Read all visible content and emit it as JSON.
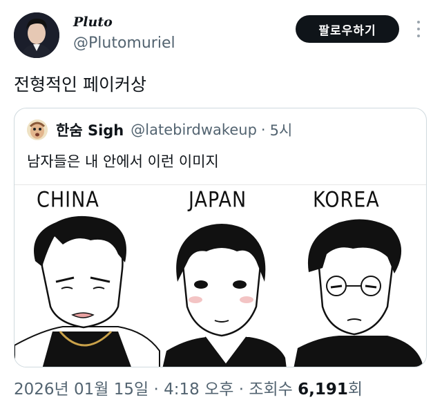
{
  "author": {
    "display_name": "Pluto",
    "handle": "@Plutomuriel",
    "follow_label": "팔로우하기"
  },
  "tweet": {
    "text": "전형적인 페이커상"
  },
  "quoted": {
    "display_name": "한숨 Sigh",
    "handle": "@latebirdwakeup",
    "separator": "·",
    "time": "5시",
    "text": "남자들은 내 안에서 이런 이미지",
    "image": {
      "labels": [
        "CHINA",
        "JAPAN",
        "KOREA"
      ]
    }
  },
  "meta": {
    "date": "2026년 01월 15일",
    "sep1": "·",
    "time": "4:18 오후",
    "sep2": "·",
    "views_label": "조회수",
    "views_count": "6,191",
    "views_suffix": "회"
  },
  "icons": {
    "more": "more-vertical-icon"
  },
  "colors": {
    "text_primary": "#0f1419",
    "text_secondary": "#536471",
    "follow_button_bg": "#0f1419",
    "border": "#cfd9de"
  }
}
